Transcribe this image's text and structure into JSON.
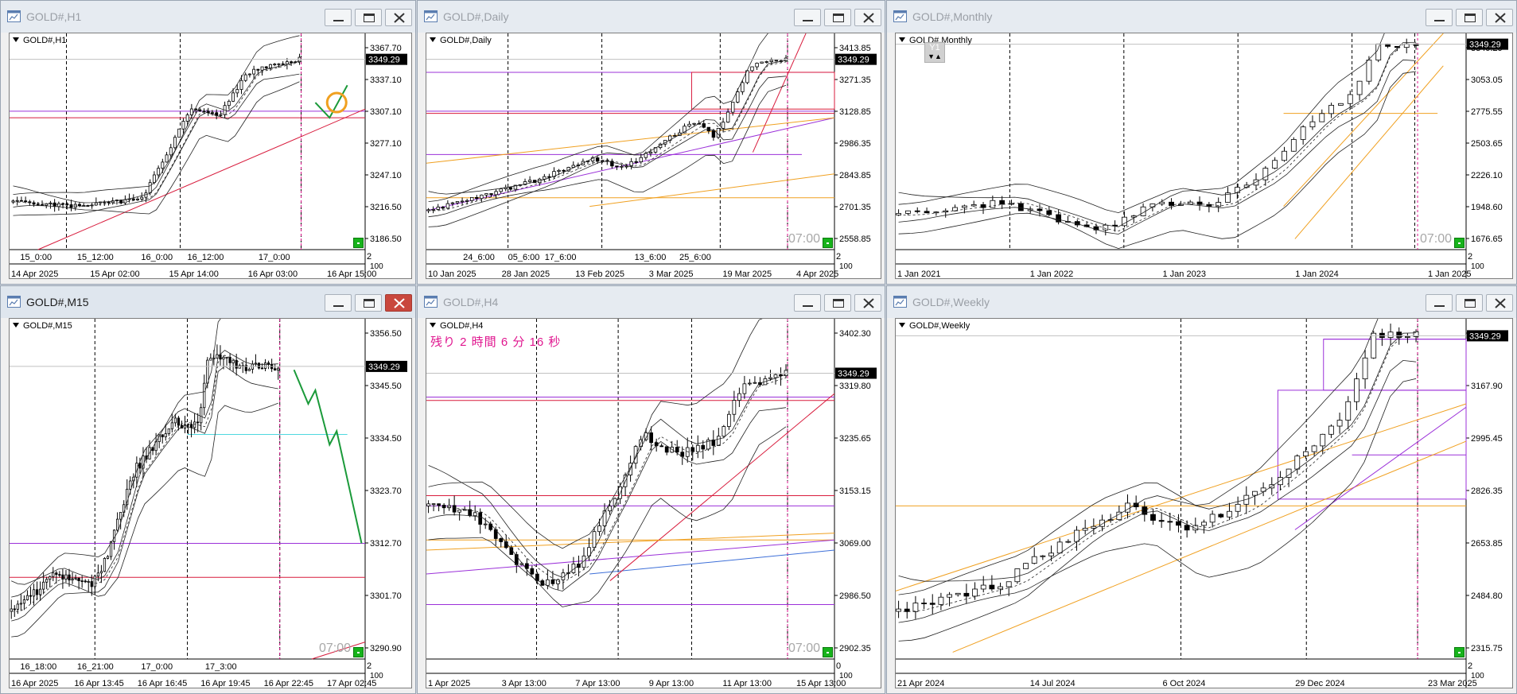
{
  "windows": [
    {
      "id": "h1",
      "title": "GOLD#,H1",
      "chart_label": "GOLD#,H1",
      "price_labels": [
        "3367.70",
        "3337.10",
        "3307.10",
        "3277.10",
        "3247.10",
        "3216.50",
        "3186.50"
      ],
      "current_price": "3349.29",
      "inner_times": [
        "15_0:00",
        "15_12:00",
        "16_0:00",
        "16_12:00",
        "17_0:00"
      ],
      "date_labels": [
        "14 Apr 2025",
        "15 Apr 02:00",
        "15 Apr 14:00",
        "16 Apr 03:00",
        "16 Apr 15:00"
      ],
      "corner": "2",
      "corner_sub": "100",
      "active": false,
      "close_red": false
    },
    {
      "id": "daily",
      "title": "GOLD#,Daily",
      "chart_label": "GOLD#,Daily",
      "price_labels": [
        "3413.85",
        "3271.35",
        "3128.85",
        "2986.35",
        "2843.85",
        "2701.35",
        "2558.85"
      ],
      "current_price": "3349.29",
      "inner_times": [
        "24_6:00",
        "05_6:00",
        "17_6:00",
        "13_6:00",
        "25_6:00"
      ],
      "date_labels": [
        "10 Jan 2025",
        "28 Jan 2025",
        "13 Feb 2025",
        "3 Mar 2025",
        "19 Mar 2025",
        "4 Apr 2025"
      ],
      "time_watermark": "07:00",
      "corner": "2",
      "corner_sub": "100",
      "active": false,
      "close_red": false
    },
    {
      "id": "monthly",
      "title": "GOLD#,Monthly",
      "chart_label": "GOLD#,Monthly",
      "y_box": "Y1",
      "price_labels": [
        "3349.29",
        "3053.05",
        "2775.55",
        "2503.65",
        "2226.10",
        "1948.60",
        "1676.65"
      ],
      "current_price": "3349.29",
      "inner_times": [],
      "date_labels": [
        "1 Jan 2021",
        "1 Jan 2022",
        "1 Jan 2023",
        "1 Jan 2024",
        "1 Jan 2025"
      ],
      "time_watermark": "07:00",
      "corner": "2",
      "corner_sub": "100",
      "active": false,
      "close_red": false
    },
    {
      "id": "m15",
      "title": "GOLD#,M15",
      "chart_label": "GOLD#,M15",
      "price_labels": [
        "3356.50",
        "3345.50",
        "3334.50",
        "3323.70",
        "3312.70",
        "3301.70",
        "3290.90"
      ],
      "current_price": "3349.29",
      "inner_times": [
        "16_18:00",
        "16_21:00",
        "17_0:00",
        "17_3:00"
      ],
      "date_labels": [
        "16 Apr 2025",
        "16 Apr 13:45",
        "16 Apr 16:45",
        "16 Apr 19:45",
        "16 Apr 22:45",
        "17 Apr 02:45"
      ],
      "time_watermark": "07:00",
      "corner": "2",
      "corner_sub": "100",
      "active": true,
      "close_red": true
    },
    {
      "id": "h4",
      "title": "GOLD#,H4",
      "chart_label": "GOLD#,H4",
      "countdown": "残り 2 時間 6 分 16 秒",
      "price_labels": [
        "3402.30",
        "3319.80",
        "3235.65",
        "3153.15",
        "3069.00",
        "2986.50",
        "2902.35"
      ],
      "current_price": "3349.29",
      "inner_times": [],
      "date_labels": [
        "1 Apr 2025",
        "3 Apr 13:00",
        "7 Apr 13:00",
        "9 Apr 13:00",
        "11 Apr 13:00",
        "15 Apr 13:00"
      ],
      "time_watermark": "07:00",
      "corner": "0",
      "corner_sub": "100",
      "active": false,
      "close_red": false
    },
    {
      "id": "weekly",
      "title": "GOLD#,Weekly",
      "chart_label": "GOLD#,Weekly",
      "price_labels": [
        "3349.29",
        "3167.90",
        "2995.45",
        "2826.35",
        "2653.85",
        "2484.80",
        "2315.75"
      ],
      "current_price": "3349.29",
      "inner_times": [],
      "date_labels": [
        "21 Apr 2024",
        "14 Jul 2024",
        "6 Oct 2024",
        "29 Dec 2024",
        "23 Mar 2025"
      ],
      "corner": "2",
      "corner_sub": "100",
      "active": false,
      "close_red": false
    }
  ],
  "icons": {
    "window": "chart-window-icon",
    "minimize": "minimize-icon",
    "maximize": "maximize-icon",
    "close": "close-icon"
  },
  "colors": {
    "bull": "#ffffff",
    "bear": "#000000",
    "band": "#000000",
    "purple": "#9b30d9",
    "red": "#d81b3c",
    "orange": "#f0a020",
    "blue": "#3d6fd8",
    "cyan": "#4fd8e0",
    "green_arrow": "#1b9a3a",
    "countdown": "#e0168f"
  }
}
